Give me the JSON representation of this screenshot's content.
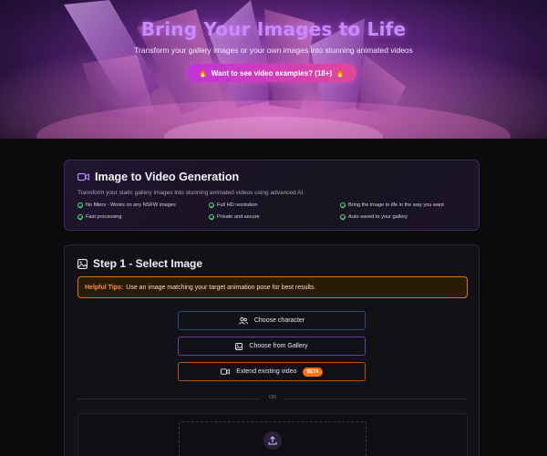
{
  "hero": {
    "title": "Bring Your Images to Life",
    "subtitle": "Transform your gallery images or your own images into stunning animated videos",
    "cta_label": "Want to see video examples? (18+)",
    "cta_icon": "fire-icon"
  },
  "info": {
    "title": "Image to Video Generation",
    "description": "Transform your static gallery images into stunning animated videos using advanced AI.",
    "features": [
      "No filters - Works on any NSFW images",
      "Full HD resolution",
      "Bring the image to life in the way you want",
      "Fast processing",
      "Private and secure",
      "Auto-saved to your gallery"
    ]
  },
  "step": {
    "title": "Step 1 - Select Image",
    "tips_label": "Helpful Tips:",
    "tips_text": "Use an image matching your target animation pose for best results.",
    "options": [
      {
        "label": "Choose character",
        "icon": "users-icon"
      },
      {
        "label": "Choose from Gallery",
        "icon": "image-icon"
      },
      {
        "label": "Extend existing video",
        "icon": "video-icon",
        "badge": "BETA"
      }
    ],
    "divider_text": "OR",
    "upload_icon": "upload-icon"
  },
  "colors": {
    "accent_purple": "#c58bff",
    "cta_gradient_start": "#c233d9",
    "cta_gradient_end": "#e0489a",
    "check_green": "#4ade80",
    "tips_orange": "#d97706",
    "beta_orange": "#f97316"
  }
}
